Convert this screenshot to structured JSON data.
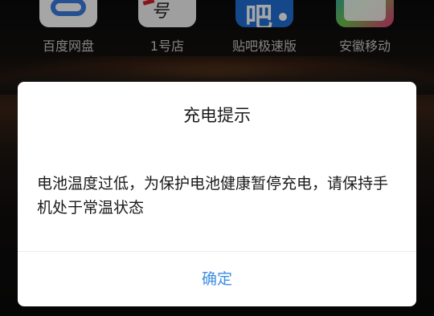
{
  "home_screen": {
    "apps": [
      {
        "label": "百度网盘",
        "icon": "baidu-netdisk-icon"
      },
      {
        "label": "1号店",
        "icon": "yhd-icon"
      },
      {
        "label": "贴吧极速版",
        "icon": "tieba-lite-icon"
      },
      {
        "label": "安徽移动",
        "icon": "anhui-mobile-icon"
      }
    ]
  },
  "dialog": {
    "title": "充电提示",
    "message": "电池温度过低，为保护电池健康暂停充电，请保持手机处于常温状态",
    "confirm_label": "确定"
  },
  "colors": {
    "dialog_background": "#ffffff",
    "confirm_text": "#3d8fe0",
    "text_primary": "#1a1a1a",
    "app_label": "#c9c9c9"
  }
}
